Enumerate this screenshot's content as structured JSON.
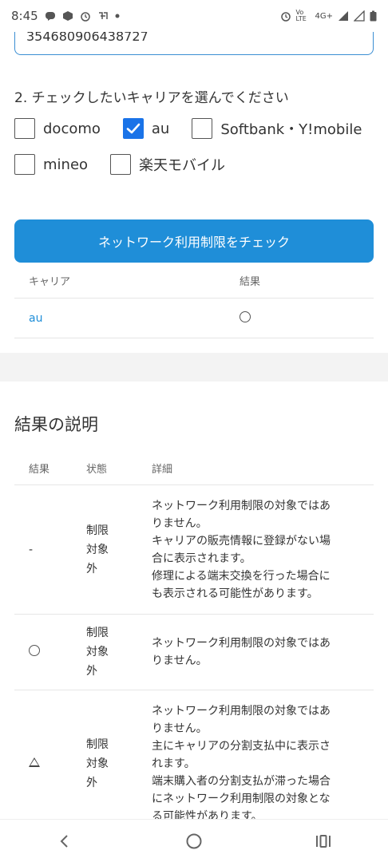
{
  "status_bar": {
    "time": "8:45",
    "network": "4G+",
    "volte": "Vo LTE"
  },
  "imei_input": {
    "value": "354680906438727"
  },
  "step2": {
    "label": "2. チェックしたいキャリアを選んでください"
  },
  "carriers": [
    {
      "label": "docomo",
      "checked": false
    },
    {
      "label": "au",
      "checked": true
    },
    {
      "label": "Softbank・Y!mobile",
      "checked": false
    },
    {
      "label": "mineo",
      "checked": false
    },
    {
      "label": "楽天モバイル",
      "checked": false
    }
  ],
  "check_button": {
    "label": "ネットワーク利用制限をチェック"
  },
  "result_table": {
    "headers": {
      "carrier": "キャリア",
      "result": "結果"
    },
    "rows": [
      {
        "carrier": "au",
        "result": "circle-icon"
      }
    ]
  },
  "explanation": {
    "title": "結果の説明",
    "headers": {
      "result": "結果",
      "status": "状態",
      "detail": "詳細"
    },
    "rows": [
      {
        "result": "-",
        "status": [
          "制限",
          "対象",
          "外"
        ],
        "detail": [
          "ネットワーク利用制限の対象ではあ",
          "りません。",
          "キャリアの販売情報に登録がない場",
          "合に表示されます。",
          "修理による端末交換を行った場合に",
          "も表示される可能性があります。"
        ]
      },
      {
        "result": "circle-icon",
        "status": [
          "制限",
          "対象",
          "外"
        ],
        "detail": [
          "ネットワーク利用制限の対象ではあ",
          "りません。"
        ]
      },
      {
        "result": "triangle-icon",
        "status": [
          "制限",
          "対象",
          "外"
        ],
        "detail": [
          "ネットワーク利用制限の対象ではあ",
          "りません。",
          "主にキャリアの分割支払中に表示さ",
          "れます。",
          "端末購入者の分割支払が滞った場合",
          "にネットワーク利用制限の対象とな",
          "る可能性があります。"
        ]
      }
    ]
  },
  "colors": {
    "accent": "#1f8ed8",
    "checkbox_checked": "#1a73e8",
    "band": "#f3f3f3"
  }
}
